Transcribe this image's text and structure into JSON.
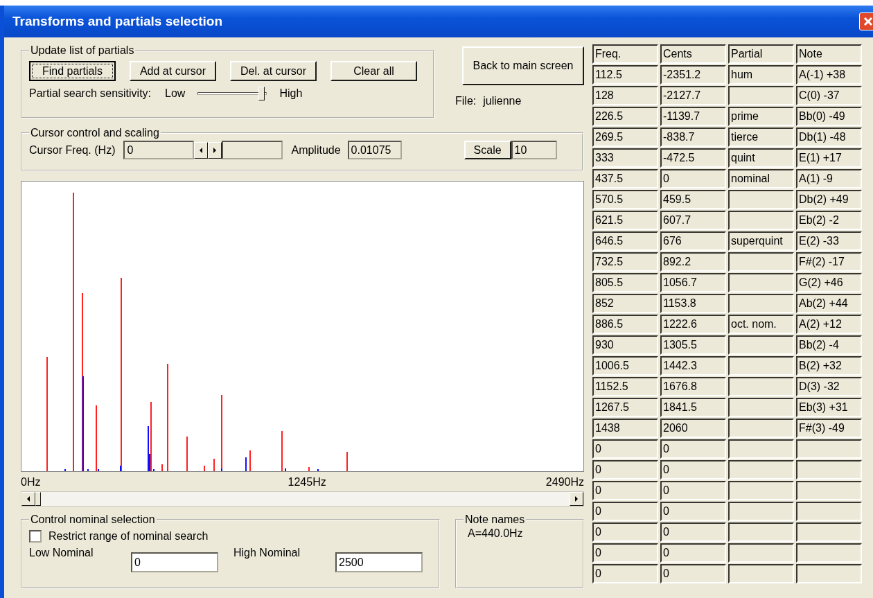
{
  "window": {
    "title": "Transforms and partials selection"
  },
  "update_group": {
    "title": "Update list of partials",
    "buttons": [
      {
        "label": "Find partials",
        "focused": true
      },
      {
        "label": "Add at cursor",
        "focused": false
      },
      {
        "label": "Del. at cursor",
        "focused": false
      },
      {
        "label": "Clear all",
        "focused": false
      }
    ],
    "sensitivity": {
      "label": "Partial search sensitivity:",
      "low": "Low",
      "high": "High",
      "level": 0.96
    }
  },
  "back_button": "Back to main screen",
  "file": {
    "label": "File:",
    "value": "julienne"
  },
  "cursor_group": {
    "title": "Cursor control and scaling",
    "freq_label": "Cursor Freq. (Hz)",
    "freq_value": "0",
    "amplitude_label": "Amplitude",
    "amplitude_value": "0.01075",
    "scale_button": "Scale",
    "scale_value": "10"
  },
  "spectrum": {
    "x_labels": [
      "0Hz",
      "1245Hz",
      "2490Hz"
    ]
  },
  "nominal_group": {
    "title": "Control nominal selection",
    "restrict": {
      "label": "Restrict range of nominal search",
      "checked": false
    },
    "low_label": "Low Nominal",
    "low_value": "0",
    "high_label": "High Nominal",
    "high_value": "2500"
  },
  "note_names": {
    "title": "Note names",
    "value": "A=440.0Hz"
  },
  "table": {
    "columns": [
      "Freq.",
      "Cents",
      "Partial",
      "Note"
    ],
    "rows": [
      {
        "freq": "112.5",
        "cents": "-2351.2",
        "partial": "hum",
        "note": "A(-1) +38"
      },
      {
        "freq": "128",
        "cents": "-2127.7",
        "note": "C(0) -37"
      },
      {
        "freq": "226.5",
        "cents": "-1139.7",
        "partial": "prime",
        "note": "Bb(0) -49"
      },
      {
        "freq": "269.5",
        "cents": "-838.7",
        "partial": "tierce",
        "note": "Db(1) -48"
      },
      {
        "freq": "333",
        "cents": "-472.5",
        "partial": "quint",
        "note": "E(1) +17"
      },
      {
        "freq": "437.5",
        "cents": "0",
        "partial": "nominal",
        "note": "A(1) -9"
      },
      {
        "freq": "570.5",
        "cents": "459.5",
        "note": "Db(2) +49"
      },
      {
        "freq": "621.5",
        "cents": "607.7",
        "note": "Eb(2) -2"
      },
      {
        "freq": "646.5",
        "cents": "676",
        "partial": "superquint",
        "note": "E(2) -33"
      },
      {
        "freq": "732.5",
        "cents": "892.2",
        "note": "F#(2) -17"
      },
      {
        "freq": "805.5",
        "cents": "1056.7",
        "note": "G(2) +46"
      },
      {
        "freq": "852",
        "cents": "1153.8",
        "note": "Ab(2) +44"
      },
      {
        "freq": "886.5",
        "cents": "1222.6",
        "partial": "oct. nom.",
        "note": "A(2) +12"
      },
      {
        "freq": "930",
        "cents": "1305.5",
        "note": "Bb(2) -4"
      },
      {
        "freq": "1006.5",
        "cents": "1442.3",
        "note": "B(2) +32"
      },
      {
        "freq": "1152.5",
        "cents": "1676.8",
        "note": "D(3) -32"
      },
      {
        "freq": "1267.5",
        "cents": "1841.5",
        "note": "Eb(3) +31"
      },
      {
        "freq": "1438",
        "cents": "2060",
        "note": "F#(3) -49"
      },
      {
        "freq": "0",
        "cents": "0"
      },
      {
        "freq": "0",
        "cents": "0"
      },
      {
        "freq": "0",
        "cents": "0"
      },
      {
        "freq": "0",
        "cents": "0"
      },
      {
        "freq": "0",
        "cents": "0"
      },
      {
        "freq": "0",
        "cents": "0"
      },
      {
        "freq": "0",
        "cents": "0"
      }
    ]
  }
}
